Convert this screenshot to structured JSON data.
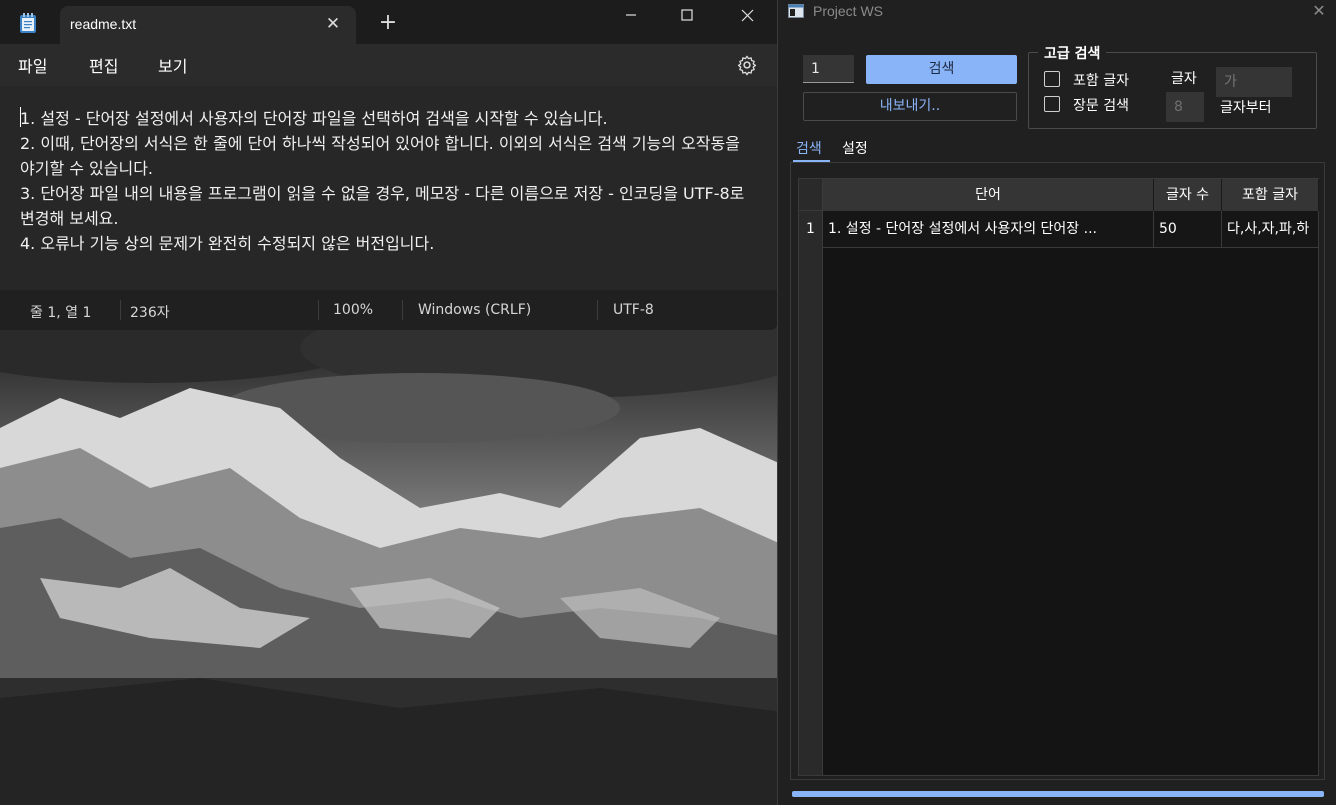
{
  "notepad": {
    "tab_title": "readme.txt",
    "new_tab_glyph": "+",
    "tab_close_glyph": "✕",
    "menu": [
      "파일",
      "편집",
      "보기"
    ],
    "content": "1. 설정 - 단어장 설정에서 사용자의 단어장 파일을 선택하여 검색을 시작할 수 있습니다.\n2. 이때, 단어장의 서식은 한 줄에 단어 하나씩 작성되어 있어야 합니다. 이외의 서식은 검색 기능의 오작동을 야기할 수 있습니다.\n3. 단어장 파일 내의 내용을 프로그램이 읽을 수 없을 경우, 메모장 - 다른 이름으로 저장 - 인코딩을 UTF-8로 변경해 보세요.\n4. 오류나 기능 상의 문제가 완전히 수정되지 않은 버전입니다.",
    "status": {
      "position": "줄 1, 열 1",
      "chars": "236자",
      "zoom": "100%",
      "line_ending": "Windows (CRLF)",
      "encoding": "UTF-8"
    }
  },
  "pws": {
    "title": "Project WS",
    "close_glyph": "✕",
    "number_value": "1",
    "search_label": "검색",
    "export_label": "내보내기..",
    "advanced": {
      "title": "고급 검색",
      "include_label": "포함 글자",
      "include_checked": false,
      "long_label": "장문 검색",
      "long_checked": false,
      "char_label": "글자",
      "char_placeholder": "가",
      "from_value": "8",
      "from_label": "글자부터"
    },
    "tabs": [
      "검색",
      "설정"
    ],
    "table": {
      "columns": [
        "단어",
        "글자 수",
        "포함 글자"
      ],
      "rows": [
        {
          "index": "1",
          "word": "1. 설정 - 단어장 설정에서 사용자의 단어장 ...",
          "length": "50",
          "included": "다,사,자,파,하"
        }
      ]
    },
    "progress": 1.0,
    "accent_color": "#8ab4f8"
  }
}
